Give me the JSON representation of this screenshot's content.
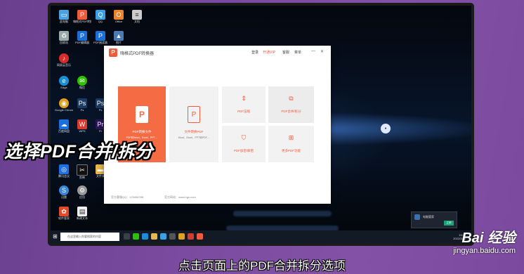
{
  "app": {
    "title": "嗨格式PDF转换器",
    "menu": [
      "登录",
      "开通VIP",
      "客服",
      "菜单"
    ],
    "tiles": {
      "pdf_convert": {
        "label": "PDF转换文件",
        "sub": "PDF转Word、Excel、PPT…"
      },
      "file_to_pdf": {
        "label": "文件转换PDF",
        "sub": "Word、Excel、PPT转PDF…"
      },
      "compress": {
        "label": "PDF压缩"
      },
      "merge_split": {
        "label": "PDF合并/拆分"
      },
      "encrypt": {
        "label": "PDF加密/解密"
      },
      "more": {
        "label": "更多PDF功能"
      }
    },
    "footer_left": "官方客服QQ：123456789",
    "footer_right": "官方网站：www.hgs.com"
  },
  "taskbar": {
    "search_placeholder": "在这里输入你要搜索的内容",
    "time": "13:57",
    "date": "2022/3/20"
  },
  "notification": {
    "text": "电脑管家",
    "button": "立即"
  },
  "overlay": {
    "headline": "选择PDF合并/拆分",
    "subtitle": "点击页面上的PDF合并拆分选项",
    "watermark_logo": "Bai 经验",
    "watermark_url": "jingyan.baidu.com"
  },
  "desktop_icons": [
    {
      "label": "此电脑",
      "color": "#4aa3e0"
    },
    {
      "label": "嗨格式PDF转换器",
      "color": "#f25a3c"
    },
    {
      "label": "QQ",
      "color": "#3aa0e8"
    },
    {
      "label": "Office",
      "color": "#e9842c"
    },
    {
      "label": "文档",
      "color": "#ccc"
    },
    {
      "label": "回收站",
      "color": "#9aa"
    },
    {
      "label": "PDF编辑器",
      "color": "#1a6fd6"
    },
    {
      "label": "PDF阅读器",
      "color": "#1a6fd6"
    },
    {
      "label": "图片",
      "color": "#4a7bb5"
    },
    {
      "label": "网易云音乐",
      "color": "#d92b2b"
    },
    {
      "label": "Edge",
      "color": "#1a8fd6"
    },
    {
      "label": "微信",
      "color": "#2dc100"
    },
    {
      "label": "Google Chrome",
      "color": "#e0a020"
    },
    {
      "label": "Ps",
      "color": "#1b3a64"
    },
    {
      "label": "百度网盘",
      "color": "#1a70e0"
    },
    {
      "label": "WPS",
      "color": "#d63b2f"
    },
    {
      "label": "Pr",
      "color": "#2a1657"
    },
    {
      "label": "腾讯会议",
      "color": "#1c6fe6"
    },
    {
      "label": "剪映",
      "color": "#111"
    },
    {
      "label": "文件夹",
      "color": "#e8b84a"
    },
    {
      "label": "迅雷",
      "color": "#3a86d6"
    },
    {
      "label": "应用",
      "color": "#999"
    },
    {
      "label": "软件管家",
      "color": "#e04a2a"
    },
    {
      "label": "新建文本",
      "color": "#eee"
    }
  ]
}
